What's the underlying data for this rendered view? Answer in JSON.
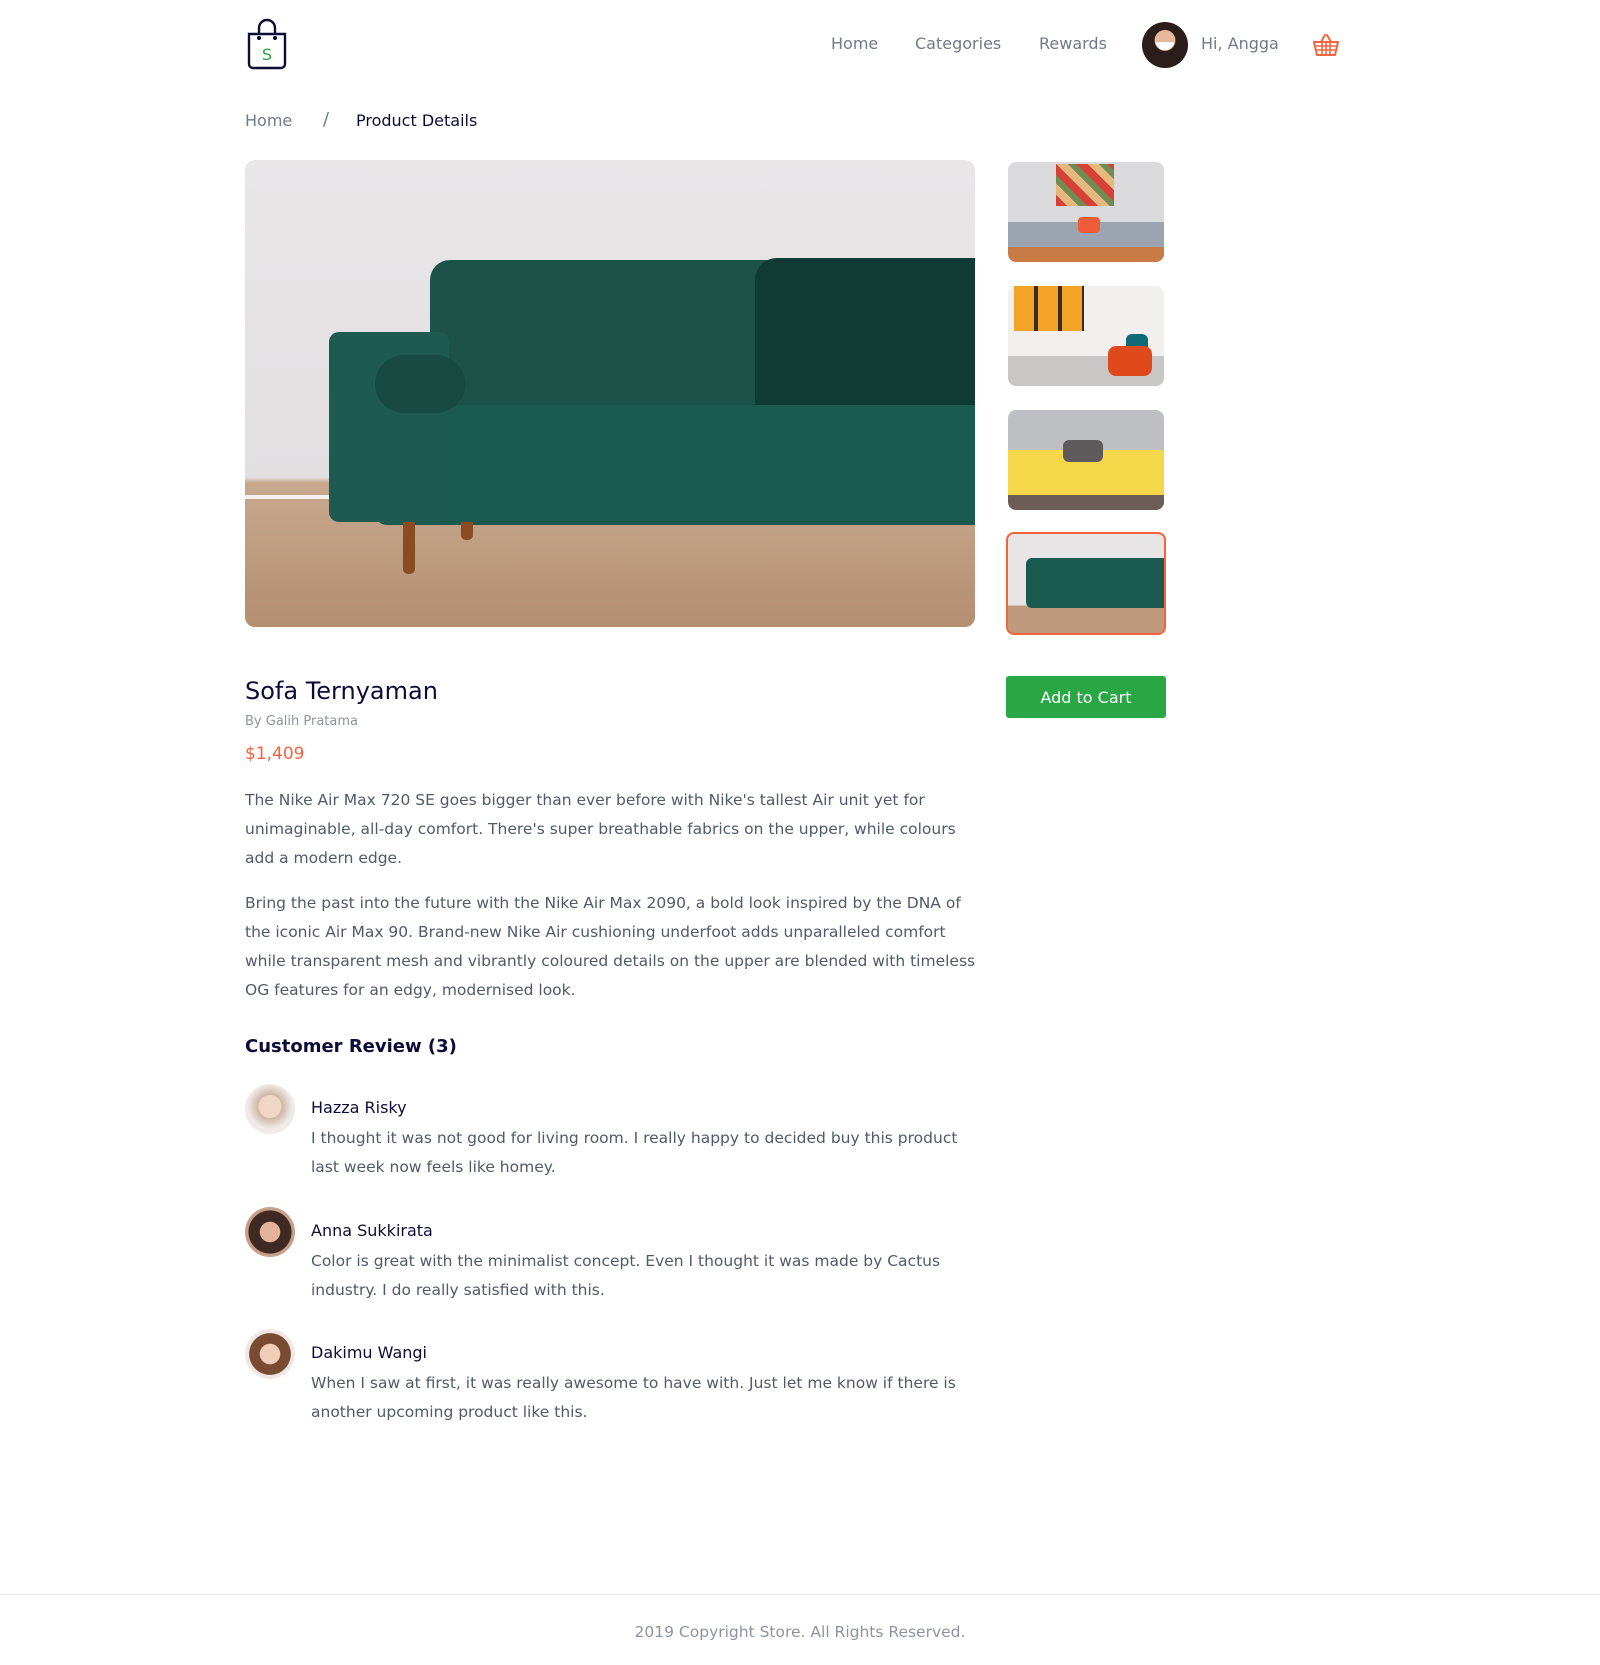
{
  "header": {
    "nav": {
      "home": "Home",
      "categories": "Categories",
      "rewards": "Rewards"
    },
    "greeting": "Hi, Angga",
    "logo_letter": "S",
    "logo_icon": "shopping-bag-icon",
    "cart_icon": "basket-icon"
  },
  "breadcrumb": {
    "home": "Home",
    "separator": "/",
    "current": "Product Details"
  },
  "product": {
    "title": "Sofa Ternyaman",
    "author": "By Galih Pratama",
    "price": "$1,409",
    "description_1": "The Nike Air Max 720 SE goes bigger than ever before with Nike's tallest Air unit yet for unimaginable, all-day comfort. There's super breathable fabrics on the upper, while colours add a modern edge.",
    "description_2": "Bring the past into the future with the Nike Air Max 2090, a bold look inspired by the DNA of the iconic Air Max 90. Brand-new Nike Air cushioning underfoot adds unparalleled comfort while transparent mesh and vibrantly coloured details on the upper are blended with timeless OG features for an edgy, modernised look.",
    "add_to_cart_label": "Add to Cart",
    "selected_thumbnail": 4
  },
  "reviews": {
    "heading": "Customer Review (3)",
    "items": [
      {
        "name": "Hazza Risky",
        "text": "I thought it was not good for living room. I really happy to decided buy this product last week now feels like homey."
      },
      {
        "name": "Anna Sukkirata",
        "text": "Color is great with the minimalist concept. Even I thought it was made by Cactus industry. I do really satisfied with this."
      },
      {
        "name": "Dakimu Wangi",
        "text": "When I saw at first, it was really awesome to have with. Just let me know if there is another upcoming product like this."
      }
    ]
  },
  "footer": {
    "text": "2019 Copyright Store. All Rights Reserved."
  },
  "colors": {
    "accent": "#f5633e",
    "primary_button": "#29a744",
    "heading": "#0c0d36",
    "muted": "#707a8a"
  }
}
